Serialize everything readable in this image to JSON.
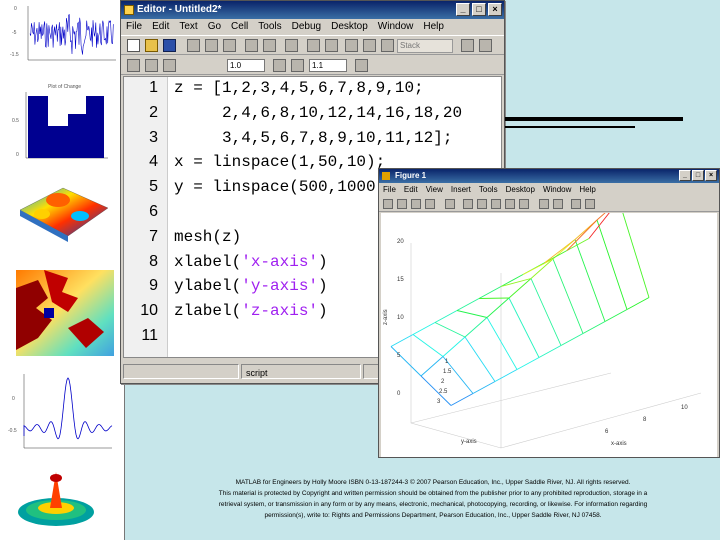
{
  "sidebar": {
    "thumb_plots": [
      {
        "name": "noise-signal-plot",
        "xlabel": "",
        "title": ""
      },
      {
        "name": "bar-histogram-plot",
        "title": "Plot of Change"
      },
      {
        "name": "surface-3d-plot"
      },
      {
        "name": "fractal-map-plot"
      },
      {
        "name": "sinc-line-plot"
      },
      {
        "name": "surface-sombrero-plot"
      }
    ],
    "ticks": {
      "noise_y": [
        "0",
        "-5",
        "-1.5"
      ],
      "bar_y": [
        "0.5",
        "0"
      ],
      "sinc_y": [
        "0",
        "-0.5"
      ]
    }
  },
  "editor": {
    "title": "Editor - Untitled2*",
    "menu": [
      "File",
      "Edit",
      "Text",
      "Go",
      "Cell",
      "Tools",
      "Debug",
      "Desktop",
      "Window",
      "Help"
    ],
    "cell_field_a": "1.0",
    "cell_field_b": "1.1",
    "status_text": "script",
    "lines": [
      {
        "n": "1",
        "code": "z = [1,2,3,4,5,6,7,8,9,10;"
      },
      {
        "n": "2",
        "code": "     2,4,6,8,10,12,14,16,18,20"
      },
      {
        "n": "3",
        "code": "     3,4,5,6,7,8,9,10,11,12];"
      },
      {
        "n": "4",
        "code": "x = linspace(1,50,10);"
      },
      {
        "n": "5",
        "code": "y = linspace(500,1000"
      },
      {
        "n": "6",
        "code": ""
      },
      {
        "n": "7",
        "code": "mesh(z)"
      },
      {
        "n": "8",
        "pre": "xlabel(",
        "str": "'x-axis'",
        "post": ")"
      },
      {
        "n": "9",
        "pre": "ylabel(",
        "str": "'y-axis'",
        "post": ")"
      },
      {
        "n": "10",
        "pre": "zlabel(",
        "str": "'z-axis'",
        "post": ")"
      },
      {
        "n": "11",
        "code": ""
      }
    ]
  },
  "figure": {
    "title": "Figure 1",
    "menu": [
      "File",
      "Edit",
      "View",
      "Insert",
      "Tools",
      "Desktop",
      "Window",
      "Help"
    ],
    "z_ticks": [
      "20",
      "15",
      "10",
      "5",
      "0"
    ],
    "y_ticks": [
      "3",
      "2.5",
      "2",
      "1.5",
      "1"
    ],
    "x_ticks": [
      "10",
      "8",
      "6"
    ],
    "xlabel": "x-axis",
    "ylabel": "y-axis",
    "zlabel": "z-axis"
  },
  "caption": {
    "line1": "MATLAB for Engineers by Holly Moore ISBN 0-13-187244-3 © 2007 Pearson Education, Inc., Upper Saddle River, NJ. All rights reserved.",
    "line2": "This material is protected by Copyright and written permission should be obtained from the publisher prior to any prohibited reproduction, storage in a",
    "line3": "retrieval system, or transmission in any form or by any means, electronic, mechanical, photocopying, recording, or likewise. For information regarding",
    "line4": "permission(s), write to: Rights and Permissions Department, Pearson Education, Inc., Upper Saddle River, NJ 07458."
  },
  "colors": {
    "background": "#c6e6ea",
    "titlebar": "#0a246a",
    "string": "#a020f0"
  }
}
